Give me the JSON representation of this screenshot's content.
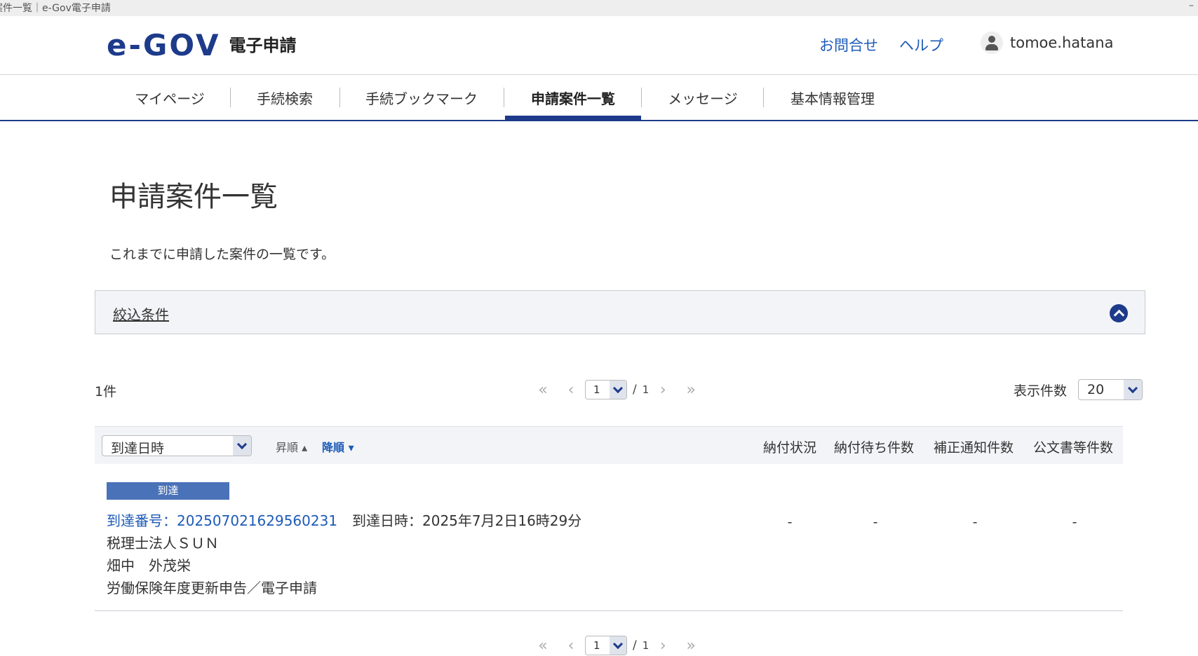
{
  "window": {
    "title": "案件一覧｜e-Gov電子申請",
    "min": "–"
  },
  "header": {
    "logo_text": "e-GOV",
    "logo_sub": "電子申請",
    "contact": "お問合せ",
    "help": "ヘルプ",
    "username": "tomoe.hatana"
  },
  "nav": {
    "items": [
      {
        "label": "マイページ"
      },
      {
        "label": "手続検索"
      },
      {
        "label": "手続ブックマーク"
      },
      {
        "label": "申請案件一覧"
      },
      {
        "label": "メッセージ"
      },
      {
        "label": "基本情報管理"
      }
    ],
    "active_index": 3
  },
  "main": {
    "title": "申請案件一覧",
    "description": "これまでに申請した案件の一覧です。",
    "filter_label": "絞込条件"
  },
  "list": {
    "count": "1件",
    "pager": {
      "first": "«",
      "prev": "‹",
      "page": "1",
      "slash": "/",
      "total": "1",
      "next": "›",
      "last": "»"
    },
    "per_page_label": "表示件数",
    "per_page_value": "20",
    "sort": {
      "field": "到達日時",
      "asc": "昇順 ▴",
      "desc": "降順 ▾"
    },
    "columns": [
      "納付状況",
      "納付待ち件数",
      "補正通知件数",
      "公文書等件数"
    ]
  },
  "rows": [
    {
      "status": "到達",
      "arrival_number": "到達番号：202507021629560231",
      "arrival_date": "到達日時：2025年7月2日16時29分",
      "org": "税理士法人ＳＵＮ",
      "person": "畑中　外茂栄",
      "procedure": "労働保険年度更新申告／電子申請",
      "values": [
        "-",
        "-",
        "-",
        "-"
      ]
    }
  ]
}
